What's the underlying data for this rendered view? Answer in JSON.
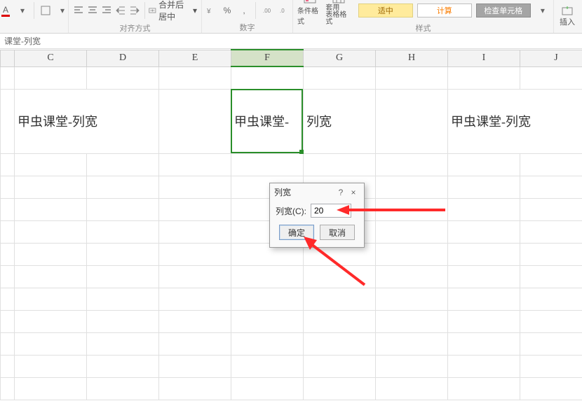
{
  "ribbon": {
    "font_btn": "A",
    "merge_label": "合并后居中",
    "percent": "%",
    "comma": ",",
    "cond_fmt": "条件格式",
    "table_fmt": "套用\n表格格式",
    "styles": {
      "good": "适中",
      "calc": "计算",
      "check": "检查单元格"
    },
    "insert": "插入",
    "group_align": "对齐方式",
    "group_number": "数字",
    "group_styles": "样式"
  },
  "formula_bar": {
    "text": "课堂-列宽"
  },
  "columns": [
    "C",
    "D",
    "E",
    "F",
    "G",
    "H",
    "I",
    "J"
  ],
  "selected_col": "F",
  "cells": {
    "c_text": "甲虫课堂-列宽",
    "f_text": "甲虫课堂-",
    "g_text": "列宽",
    "i_text": "甲虫课堂-列宽"
  },
  "dialog": {
    "title": "列宽",
    "help": "?",
    "close": "×",
    "label": "列宽(C):",
    "value": "20",
    "ok": "确定",
    "cancel": "取消"
  }
}
